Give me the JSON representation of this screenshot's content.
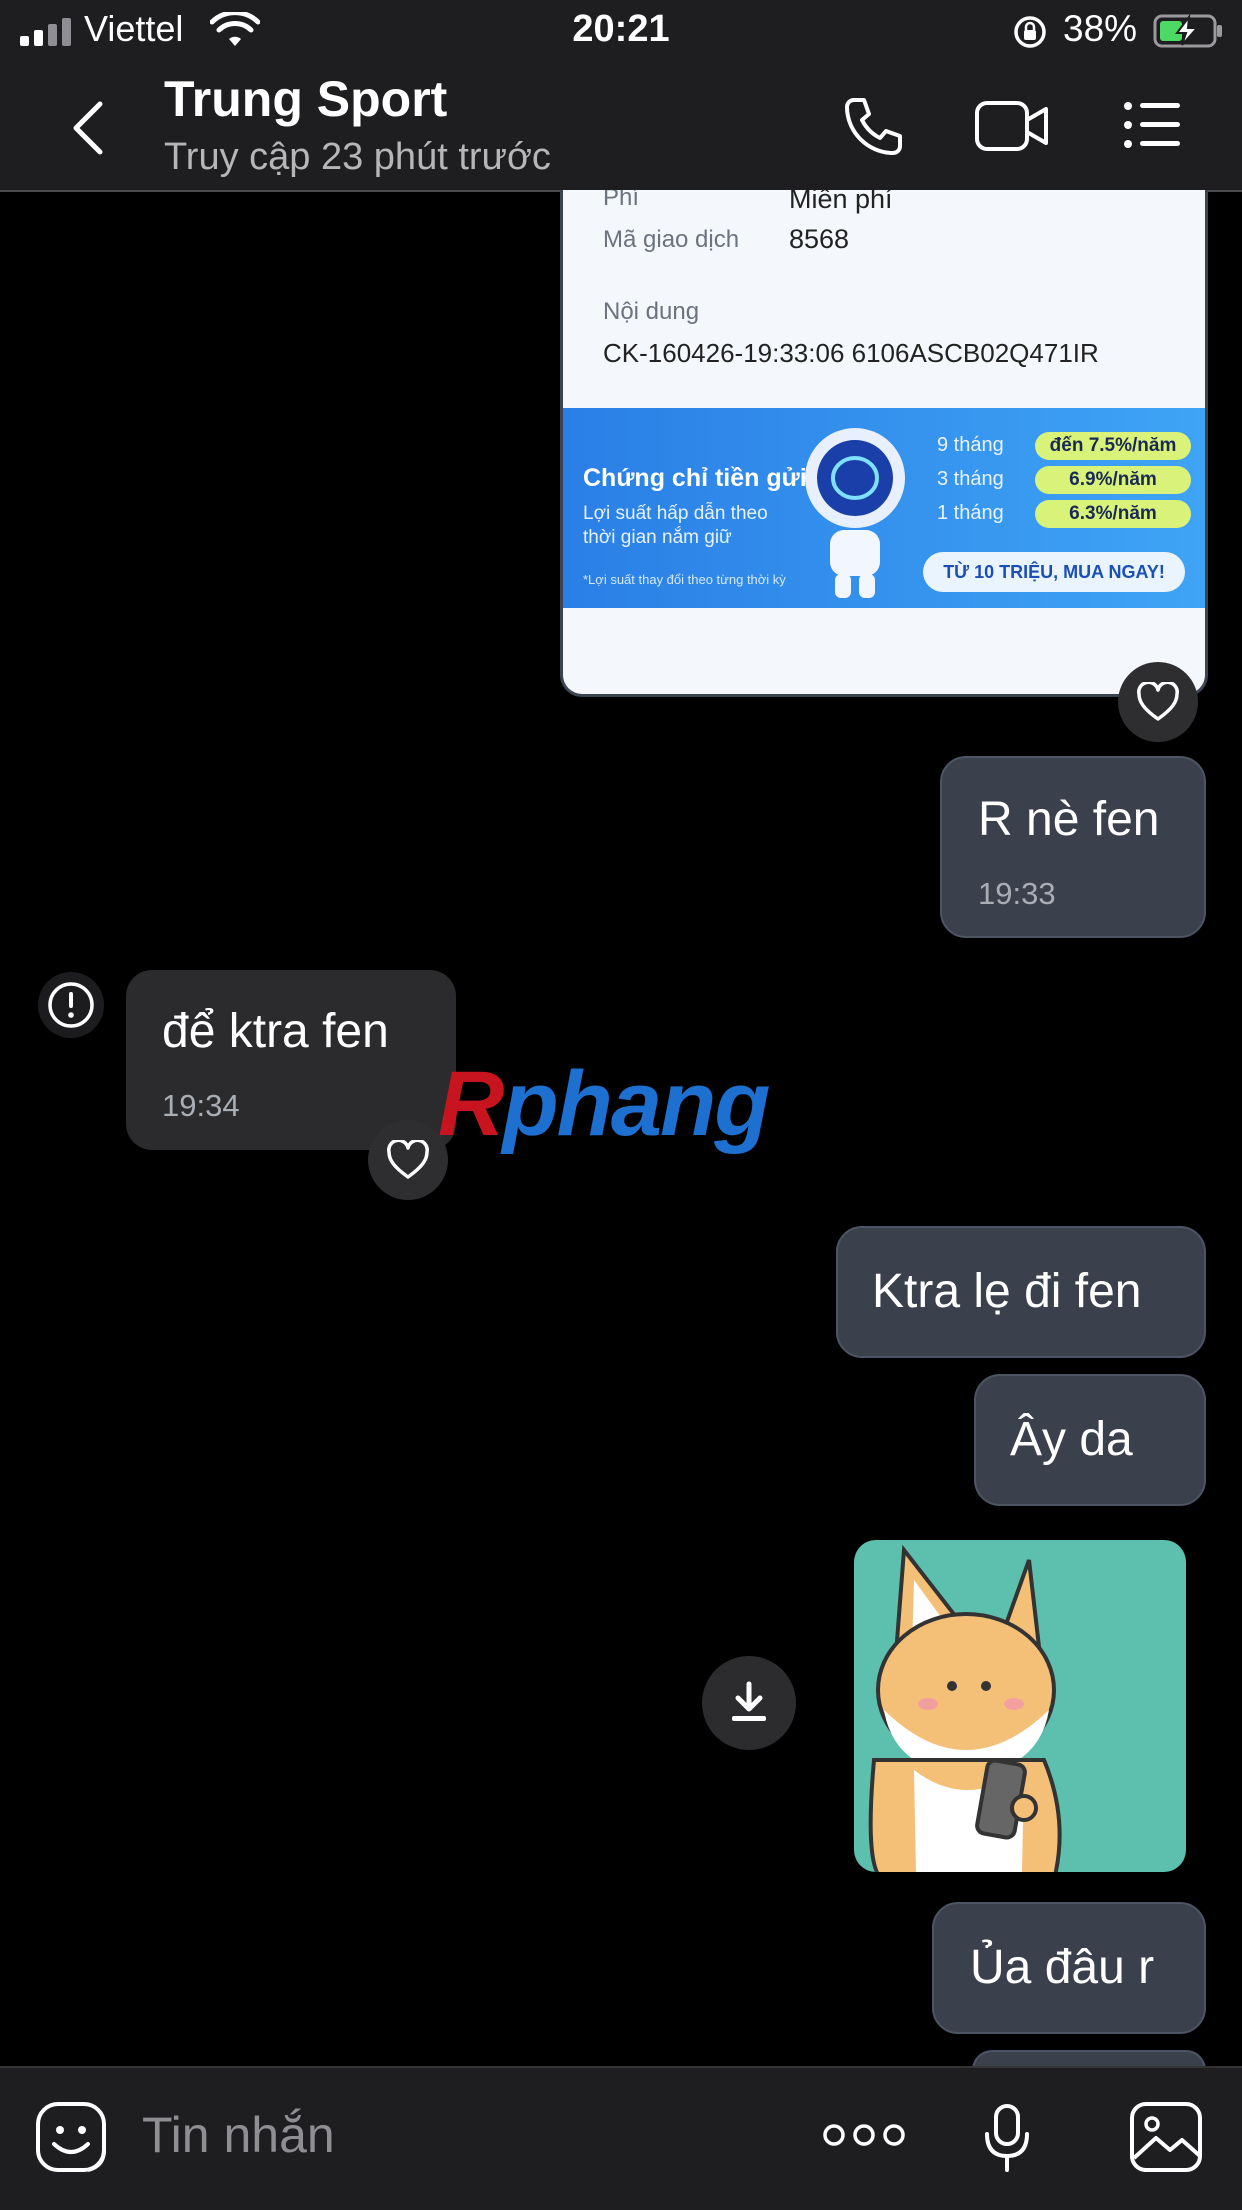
{
  "status_bar": {
    "carrier": "Viettel",
    "time": "20:21",
    "battery_percent": "38%"
  },
  "header": {
    "title": "Trung Sport",
    "subtitle": "Truy cập 23 phút trước"
  },
  "receipt": {
    "fee_label": "Phí",
    "fee_value": "Miễn phí",
    "transaction_label": "Mã giao dịch",
    "transaction_value": "8568",
    "content_label": "Nội dung",
    "content_value": "CK-160426-19:33:06 6106ASCB02Q471IR",
    "banner": {
      "headline": "Chứng chỉ tiền gửi",
      "sub_line1": "Lợi suất hấp dẫn theo",
      "sub_line2": "thời gian nắm giữ",
      "note": "*Lợi suất thay đổi theo từng thời kỳ",
      "rates": [
        {
          "term": "9 tháng",
          "rate": "đến 7.5%/năm"
        },
        {
          "term": "3 tháng",
          "rate": "6.9%/năm"
        },
        {
          "term": "1 tháng",
          "rate": "6.3%/năm"
        }
      ],
      "cta": "TỪ 10 TRIỆU, MUA NGAY!"
    }
  },
  "messages": [
    {
      "direction": "out",
      "text": "R nè fen",
      "time": "19:33"
    },
    {
      "direction": "in",
      "text": "để ktra fen",
      "time": "19:34"
    },
    {
      "direction": "out",
      "text": "Ktra lẹ đi fen"
    },
    {
      "direction": "out",
      "text": "Ây da"
    },
    {
      "direction": "out",
      "type": "sticker",
      "description": "fox-looking-at-phone-sticker"
    },
    {
      "direction": "out",
      "text": "Ủa đâu r"
    }
  ],
  "watermark": {
    "part1": "R",
    "part2": "phang"
  },
  "composer": {
    "placeholder": "Tin nhắn"
  },
  "colors": {
    "background": "#000000",
    "bar": "#1e1e20",
    "outgoing_bubble": "#3a414d",
    "incoming_bubble": "#2b2b2d"
  }
}
